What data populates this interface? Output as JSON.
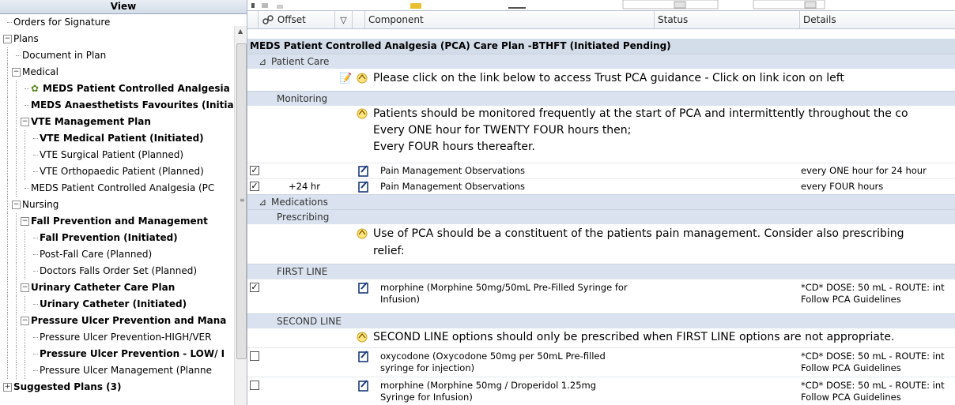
{
  "left_panel": {
    "header": "View",
    "tree": [
      {
        "label": "Orders for Signature",
        "level": 0,
        "toggle": "",
        "bold": false
      },
      {
        "label": "Plans",
        "level": 0,
        "toggle": "−",
        "bold": false
      },
      {
        "label": "Document in Plan",
        "level": 1,
        "toggle": "",
        "bold": false
      },
      {
        "label": "Medical",
        "level": 1,
        "toggle": "−",
        "bold": false
      },
      {
        "label": "MEDS Patient Controlled Analgesia",
        "level": 2,
        "toggle": "",
        "bold": true,
        "icon": "plan-icon"
      },
      {
        "label": "MEDS Anaesthetists Favourites (Initia",
        "level": 2,
        "toggle": "",
        "bold": true
      },
      {
        "label": "VTE Management Plan",
        "level": 2,
        "toggle": "−",
        "bold": true
      },
      {
        "label": "VTE Medical Patient (Initiated)",
        "level": 3,
        "toggle": "",
        "bold": true
      },
      {
        "label": "VTE Surgical Patient (Planned)",
        "level": 3,
        "toggle": "",
        "bold": false
      },
      {
        "label": "VTE Orthopaedic Patient (Planned)",
        "level": 3,
        "toggle": "",
        "bold": false
      },
      {
        "label": "MEDS Patient Controlled Analgesia (PC",
        "level": 2,
        "toggle": "",
        "bold": false
      },
      {
        "label": "Nursing",
        "level": 1,
        "toggle": "−",
        "bold": false
      },
      {
        "label": "Fall Prevention and Management",
        "level": 2,
        "toggle": "−",
        "bold": true
      },
      {
        "label": "Fall Prevention (Initiated)",
        "level": 3,
        "toggle": "",
        "bold": true
      },
      {
        "label": "Post-Fall Care (Planned)",
        "level": 3,
        "toggle": "",
        "bold": false
      },
      {
        "label": "Doctors Falls Order Set (Planned)",
        "level": 3,
        "toggle": "",
        "bold": false
      },
      {
        "label": "Urinary Catheter Care Plan",
        "level": 2,
        "toggle": "−",
        "bold": true
      },
      {
        "label": "Urinary Catheter (Initiated)",
        "level": 3,
        "toggle": "",
        "bold": true
      },
      {
        "label": "Pressure Ulcer Prevention and Mana",
        "level": 2,
        "toggle": "−",
        "bold": true
      },
      {
        "label": "Pressure Ulcer Prevention-HIGH/VER",
        "level": 3,
        "toggle": "",
        "bold": false
      },
      {
        "label": "Pressure Ulcer Prevention - LOW/ I",
        "level": 3,
        "toggle": "",
        "bold": true
      },
      {
        "label": "Pressure Ulcer Management (Planne",
        "level": 3,
        "toggle": "",
        "bold": false
      },
      {
        "label": "Suggested Plans (3)",
        "level": 0,
        "toggle": "+",
        "bold": true
      }
    ]
  },
  "grid": {
    "columns": [
      "Offset",
      "Component",
      "Status",
      "Details"
    ],
    "plan_title": "MEDS Patient Controlled Analgesia (PCA) Care Plan -BTHFT (Initiated Pending)",
    "patient_care_label": "Patient Care",
    "patient_care_note": "Please click on the link below to access Trust PCA guidance - Click on link icon on left",
    "monitoring_label": "Monitoring",
    "monitoring_note": [
      "Patients should be monitored frequently at the start of PCA and intermittently throughout the co",
      "Every ONE hour for TWENTY FOUR hours then;",
      "Every FOUR hours thereafter."
    ],
    "obs_orders": [
      {
        "checked": true,
        "offset": "",
        "component": "Pain Management Observations",
        "details": "every ONE hour for 24 hour"
      },
      {
        "checked": true,
        "offset": "+24 hr",
        "component": "Pain Management Observations",
        "details": "every FOUR hours"
      }
    ],
    "medications_label": "Medications",
    "prescribing_label": "Prescribing",
    "prescribing_note": [
      "Use of PCA should be a constituent of the patients pain management. Consider also prescribing",
      "relief:"
    ],
    "first_line_label": "FIRST LINE",
    "first_line_order": {
      "checked": true,
      "component": [
        "morphine (Morphine 50mg/50mL Pre-Filled Syringe for",
        "Infusion)"
      ],
      "details": [
        "*CD* DOSE: 50 mL - ROUTE: int",
        "Follow PCA Guidelines"
      ]
    },
    "second_line_label": "SECOND LINE",
    "second_line_note": "SECOND LINE options should only be prescribed when FIRST LINE options are not appropriate.",
    "second_line_orders": [
      {
        "checked": false,
        "component": [
          "oxycodone (Oxycodone 50mg per 50mL Pre-filled",
          "syringe for injection)"
        ],
        "details": [
          "*CD* DOSE: 50 mL - ROUTE: int",
          "Follow PCA Guidelines"
        ]
      },
      {
        "checked": false,
        "component": [
          "morphine (Morphine 50mg / Droperidol 1.25mg",
          "Syringe for Infusion)"
        ],
        "details": [
          "*CD* DOSE: 50 mL - ROUTE: int",
          "Follow PCA Guidelines"
        ]
      }
    ]
  }
}
